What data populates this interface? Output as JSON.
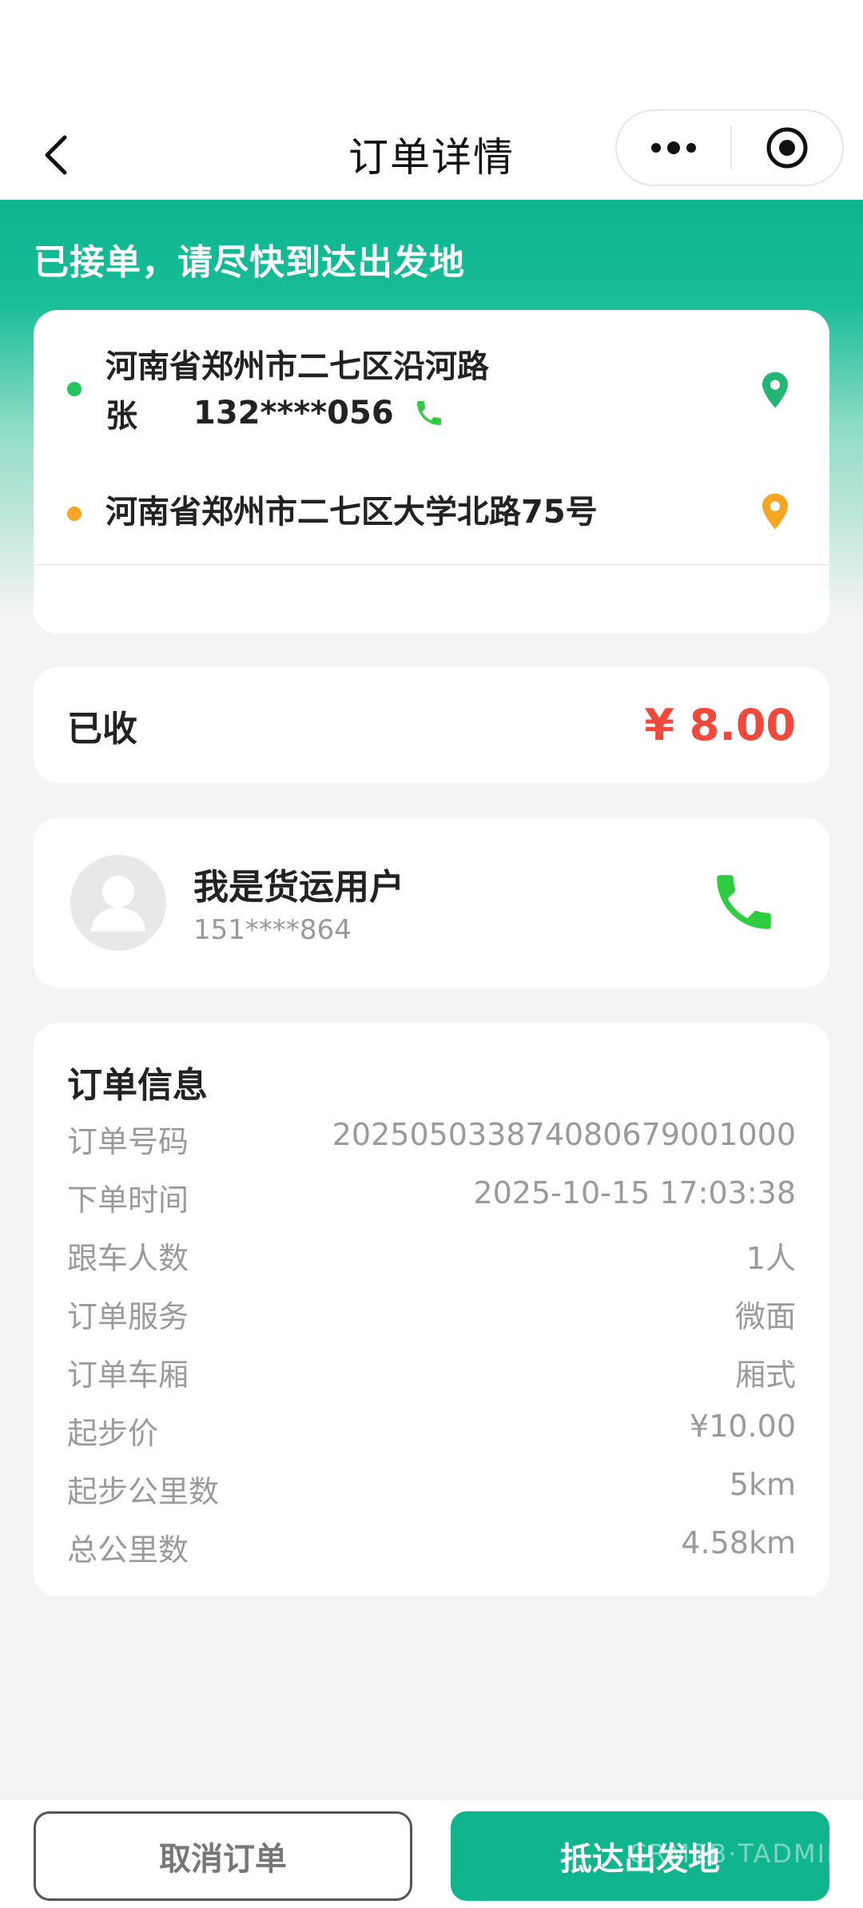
{
  "navbar": {
    "title": "订单详情"
  },
  "status": {
    "message": "已接单，请尽快到达出发地"
  },
  "route": {
    "start": {
      "address": "河南省郑州市二七区沿河路",
      "contact_name": "张",
      "contact_phone": "132****056",
      "dot_color": "#22c55e"
    },
    "end": {
      "address": "河南省郑州市二七区大学北路75号",
      "dot_color": "#f5a623"
    }
  },
  "payment": {
    "label": "已收",
    "amount": "¥ 8.00",
    "amount_color": "#f0483a"
  },
  "user": {
    "name": "我是货运用户",
    "phone": "151****864"
  },
  "order_info": {
    "title": "订单信息",
    "rows": [
      {
        "label": "订单号码",
        "value": "2025050338740806790010​00"
      },
      {
        "label": "下单时间",
        "value": "2025-10-15 17:03:38"
      },
      {
        "label": "跟车人数",
        "value": "1人"
      },
      {
        "label": "订单服务",
        "value": "微面"
      },
      {
        "label": "订单车厢",
        "value": "厢式"
      },
      {
        "label": "起步价",
        "value": "¥10.00"
      },
      {
        "label": "起步公里数",
        "value": "5km"
      },
      {
        "label": "总公里数",
        "value": "4.58km"
      }
    ]
  },
  "actions": {
    "cancel_label": "取消订单",
    "arrive_label": "抵达出发地",
    "watermark": "CRMEB·TADMIN"
  },
  "colors": {
    "primary": "#10b58e",
    "accent_red": "#f0483a",
    "phone_green": "#2ecc40"
  }
}
